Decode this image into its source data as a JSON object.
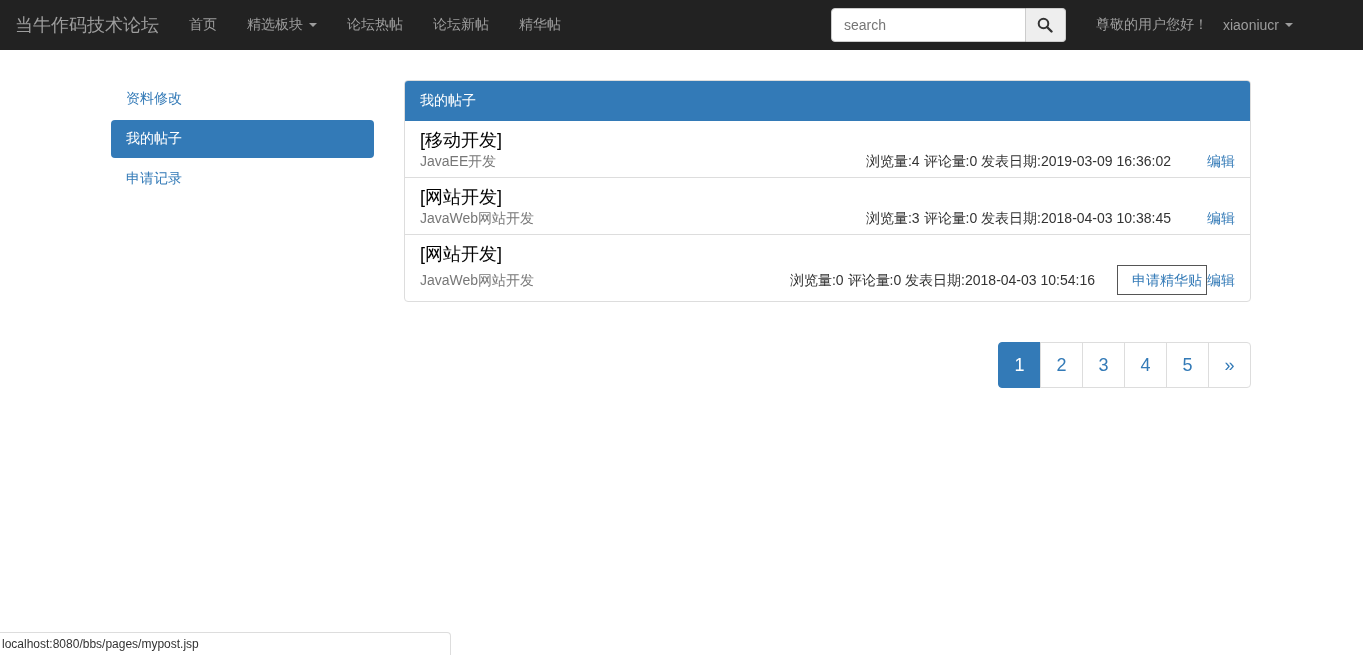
{
  "navbar": {
    "brand": "当牛作码技术论坛",
    "items": [
      {
        "label": "首页",
        "dropdown": false
      },
      {
        "label": "精选板块",
        "dropdown": true
      },
      {
        "label": "论坛热帖",
        "dropdown": false
      },
      {
        "label": "论坛新帖",
        "dropdown": false
      },
      {
        "label": "精华帖",
        "dropdown": false
      }
    ],
    "search": {
      "placeholder": "search"
    },
    "greeting": "尊敬的用户您好！",
    "user": "xiaoniucr"
  },
  "sidebar": {
    "items": [
      {
        "label": "资料修改",
        "selected": false
      },
      {
        "label": "我的帖子",
        "selected": true
      },
      {
        "label": "申请记录",
        "selected": false
      }
    ]
  },
  "panel": {
    "title": "我的帖子",
    "posts": [
      {
        "title": "[移动开发]",
        "category": "JavaEE开发",
        "stats": "浏览量:4 评论量:0 发表日期:2019-03-09 16:36:02",
        "edit": "编辑"
      },
      {
        "title": "[网站开发]",
        "category": "JavaWeb网站开发",
        "stats": "浏览量:3 评论量:0 发表日期:2018-04-03 10:38:45",
        "edit": "编辑"
      },
      {
        "title": "[网站开发]",
        "category": "JavaWeb网站开发",
        "stats": "浏览量:0 评论量:0 发表日期:2018-04-03 10:54:16",
        "apply": "申请精华贴",
        "edit": "编辑"
      }
    ]
  },
  "pagination": {
    "pages": [
      {
        "label": "1",
        "selected": true
      },
      {
        "label": "2",
        "selected": false
      },
      {
        "label": "3",
        "selected": false
      },
      {
        "label": "4",
        "selected": false
      },
      {
        "label": "5",
        "selected": false
      }
    ],
    "next": "»"
  },
  "status_bar": "localhost:8080/bbs/pages/mypost.jsp"
}
